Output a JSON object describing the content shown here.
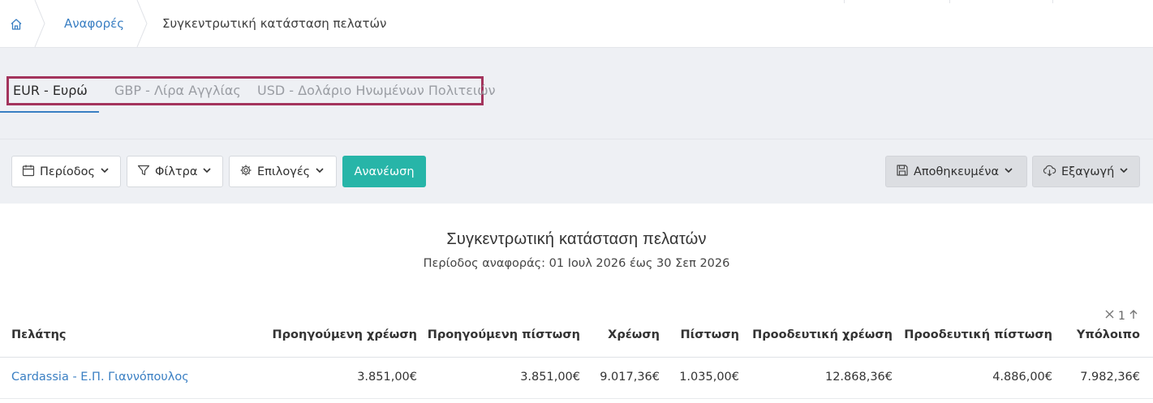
{
  "breadcrumb": {
    "home_icon": "home-icon",
    "items": [
      "Αναφορές",
      "Συγκεντρωτική κατάσταση πελατών"
    ]
  },
  "tabs": {
    "items": [
      "EUR - Ευρώ",
      "GBP - Λίρα Αγγλίας",
      "USD - Δολάριο Ηνωμένων Πολιτειών"
    ],
    "active_index": 0
  },
  "toolbar": {
    "period_label": "Περίοδος",
    "filters_label": "Φίλτρα",
    "options_label": "Επιλογές",
    "refresh_label": "Ανανέωση",
    "saved_label": "Αποθηκευμένα",
    "export_label": "Εξαγωγή"
  },
  "report": {
    "title": "Συγκεντρωτική κατάσταση πελατών",
    "subtitle": "Περίοδος αναφοράς: 01 Ιουλ 2026 έως 30 Σεπ 2026"
  },
  "sort_indicator": {
    "count": "1"
  },
  "table": {
    "headers": [
      "Πελάτης",
      "Προηγούμενη χρέωση",
      "Προηγούμενη πίστωση",
      "Χρέωση",
      "Πίστωση",
      "Προοδευτική χρέωση",
      "Προοδευτική πίστωση",
      "Υπόλοιπο"
    ],
    "rows": [
      [
        "Cardassia - Ε.Π. Γιαννόπουλος",
        "3.851,00€",
        "3.851,00€",
        "9.017,36€",
        "1.035,00€",
        "12.868,36€",
        "4.886,00€",
        "7.982,36€"
      ]
    ]
  },
  "colors": {
    "accent": "#3a7fc3",
    "refresh_button": "#27b5a8",
    "tab_highlight_border": "#a3345c"
  }
}
